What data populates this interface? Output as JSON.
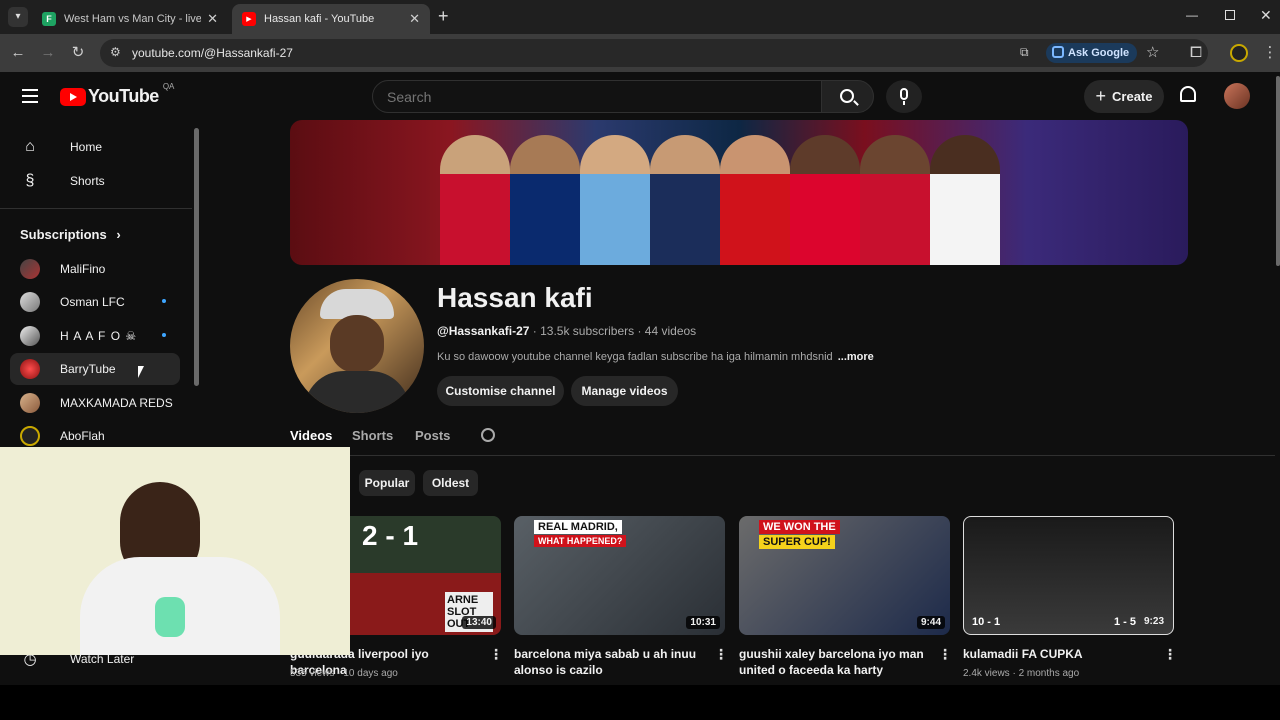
{
  "browser": {
    "tabs": [
      {
        "title": "West Ham vs Man City - live sco",
        "favicon": "sheets-icon",
        "active": false
      },
      {
        "title": "Hassan kafi - YouTube",
        "favicon": "youtube-icon",
        "active": true
      }
    ],
    "new_tab": "+",
    "url": "youtube.com/@Hassankafi-27",
    "ask_google": "Ask Google"
  },
  "yt": {
    "logo_text": "YouTube",
    "logo_region": "QA",
    "search_placeholder": "Search",
    "create_label": "Create"
  },
  "sidebar": {
    "nav": [
      {
        "label": "Home",
        "icon": "home-icon"
      },
      {
        "label": "Shorts",
        "icon": "shorts-icon"
      }
    ],
    "subscriptions_title": "Subscriptions",
    "subscriptions": [
      {
        "name": "MaliFino",
        "new": false
      },
      {
        "name": "Osman LFC",
        "new": true
      },
      {
        "name": "H A A F O ☠",
        "new": true
      },
      {
        "name": "BarryTube",
        "new": false
      },
      {
        "name": "MAXKAMADA REDS",
        "new": false
      },
      {
        "name": "AboFlah",
        "new": false
      }
    ],
    "watch_later": "Watch Later"
  },
  "channel": {
    "name": "Hassan kafi",
    "handle": "@Hassankafi-27",
    "stats": "· 13.5k subscribers · 44 videos",
    "description": "Ku so dawoow youtube channel keyga fadlan subscribe ha iga hilmamin mhdsnid",
    "more": "...more",
    "customise": "Customise channel",
    "manage": "Manage videos",
    "tabs": [
      "Videos",
      "Shorts",
      "Posts"
    ],
    "filters": [
      "Popular",
      "Oldest"
    ]
  },
  "videos": [
    {
      "title": "guuldarada liverpool iyo barcelona",
      "meta": "535 views · 10 days ago",
      "duration": "13:40",
      "thumb_text": [
        "2 - 1",
        "ARNE SLOT OUT"
      ]
    },
    {
      "title": "barcelona miya sabab u ah inuu alonso is cazilo",
      "meta": "",
      "duration": "10:31",
      "thumb_text": [
        "REAL MADRID,",
        "WHAT HAPPENED?"
      ]
    },
    {
      "title": "guushii xaley barcelona iyo man united o faceeda ka harty",
      "meta": "",
      "duration": "9:44",
      "thumb_text": [
        "WE WON THE",
        "SUPER CUP!"
      ]
    },
    {
      "title": "kulamadii FA CUPKA",
      "meta": "2.4k views · 2 months ago",
      "duration": "9:23",
      "thumb_text": [
        "10 - 1",
        "1 - 5"
      ]
    }
  ]
}
